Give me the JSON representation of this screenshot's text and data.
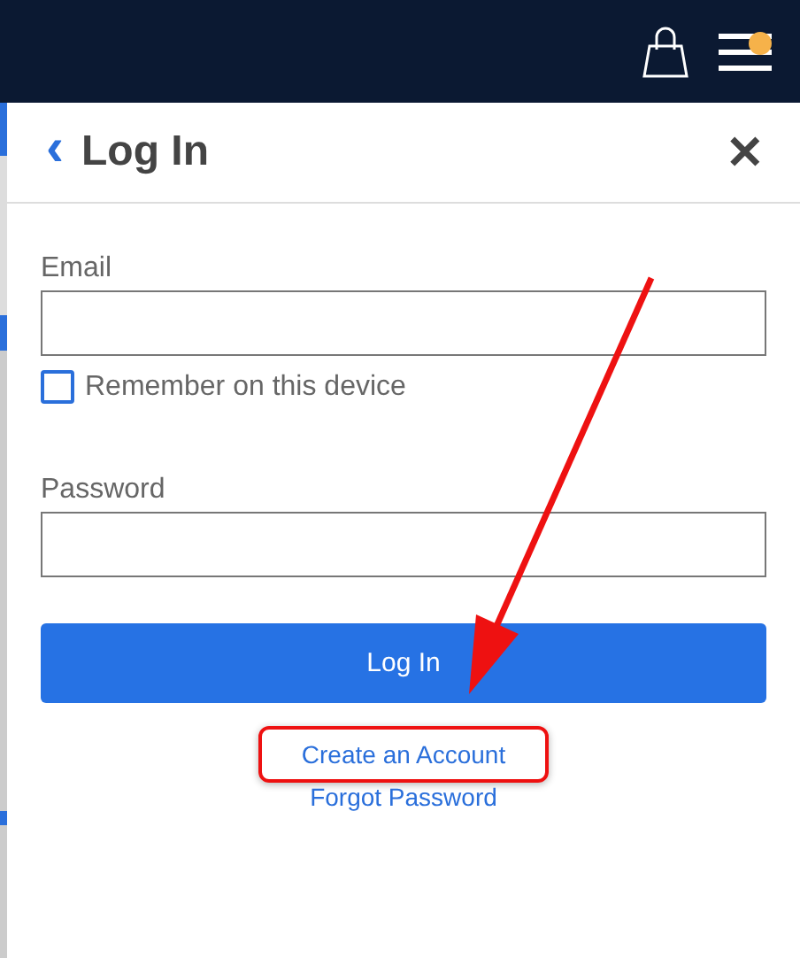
{
  "header": {
    "menu_notification": true
  },
  "panel": {
    "back_glyph": "‹",
    "title": "Log In",
    "close_glyph": "✕"
  },
  "form": {
    "email_label": "Email",
    "remember": {
      "label": "Remember on this device",
      "checked": false
    },
    "password_label": "Password",
    "submit": "Log In"
  },
  "links": [
    {
      "label": "Create an Account",
      "highlighted": true
    },
    {
      "label": "Forgot Password",
      "highlighted": false
    }
  ]
}
